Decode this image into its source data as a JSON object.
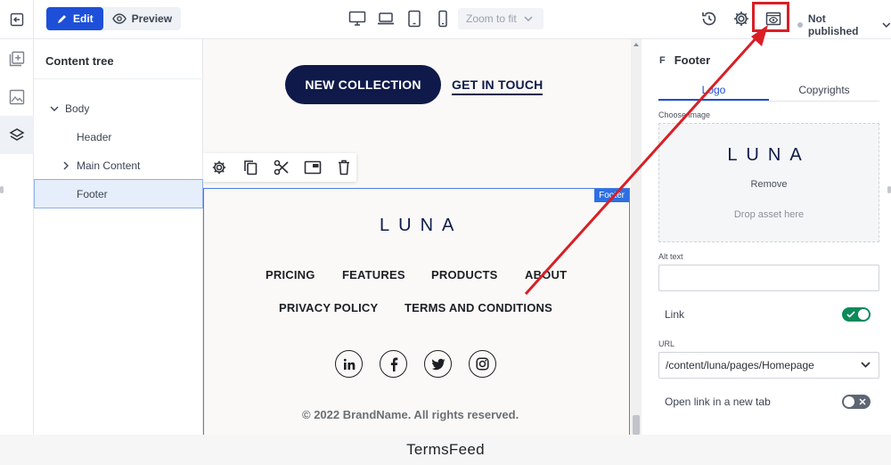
{
  "toolbar": {
    "edit_label": "Edit",
    "preview_label": "Preview",
    "zoom_label": "Zoom to fit",
    "status_label": "Not published",
    "devices": [
      "desktop-icon",
      "laptop-icon",
      "tablet-icon",
      "mobile-icon"
    ]
  },
  "tree": {
    "title": "Content tree",
    "items": [
      {
        "label": "Body"
      },
      {
        "label": "Header"
      },
      {
        "label": "Main Content"
      },
      {
        "label": "Footer"
      }
    ]
  },
  "canvas": {
    "cta_primary": "NEW COLLECTION",
    "cta_secondary": "GET IN TOUCH",
    "footer_tag": "Footer",
    "logo": "LUNA",
    "nav": [
      "PRICING",
      "FEATURES",
      "PRODUCTS",
      "ABOUT",
      "PRIVACY POLICY",
      "TERMS AND CONDITIONS"
    ],
    "socials": [
      "linkedin-icon",
      "facebook-icon",
      "twitter-icon",
      "instagram-icon"
    ],
    "copyright": "© 2022 BrandName. All rights reserved."
  },
  "panel": {
    "icon_letter": "F",
    "title": "Footer",
    "tabs": [
      "Logo",
      "Copyrights"
    ],
    "choose_image_label": "Choose image",
    "asset_logo": "LUNA",
    "remove_label": "Remove",
    "drop_label": "Drop asset here",
    "alt_text_label": "Alt text",
    "alt_text_value": "",
    "link_label": "Link",
    "link_enabled": true,
    "url_label": "URL",
    "url_value": "/content/luna/pages/Homepage",
    "new_tab_label": "Open link in a new tab",
    "new_tab_enabled": false
  },
  "banner": {
    "text": "TermsFeed"
  },
  "colors": {
    "accent": "#1d4fd8",
    "navy": "#0f1a4a",
    "annotation": "#d81f26",
    "toggle_on": "#0d8a5a"
  }
}
